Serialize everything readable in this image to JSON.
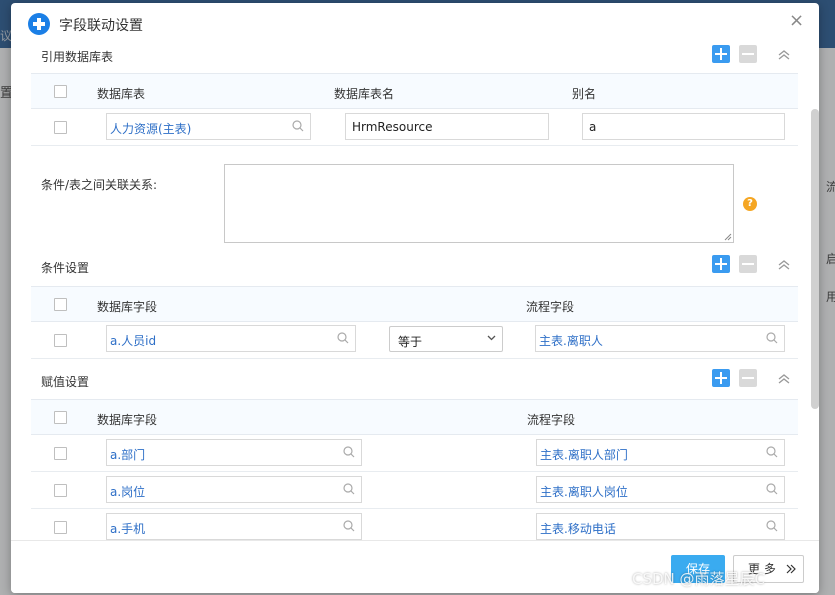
{
  "background": {
    "fragments": [
      "议",
      "置",
      "流",
      "启",
      "用"
    ]
  },
  "modal": {
    "title": "字段联动设置",
    "close_glyph": "×"
  },
  "ref_tables": {
    "title": "引用数据库表",
    "headers": [
      "数据库表",
      "数据库表名",
      "别名"
    ],
    "rows": [
      {
        "table": "人力资源(主表)",
        "table_name": "HrmResource",
        "alias": "a"
      }
    ]
  },
  "relation": {
    "label": "条件/表之间关联关系:",
    "help_glyph": "?"
  },
  "conditions": {
    "title": "条件设置",
    "headers": [
      "数据库字段",
      "流程字段"
    ],
    "rows": [
      {
        "db_field": "a.人员id",
        "operator": "等于",
        "flow_field": "主表.离职人"
      }
    ]
  },
  "assignments": {
    "title": "赋值设置",
    "headers": [
      "数据库字段",
      "流程字段"
    ],
    "rows": [
      {
        "db_field": "a.部门",
        "flow_field": "主表.离职人部门"
      },
      {
        "db_field": "a.岗位",
        "flow_field": "主表.离职人岗位"
      },
      {
        "db_field": "a.手机",
        "flow_field": "主表.移动电话"
      }
    ]
  },
  "footer": {
    "save_label": "保存",
    "more_label": "更 多"
  },
  "watermark": "CSDN @雨落星辰C",
  "colors": {
    "primary": "#3a9bf0",
    "link_text": "#2e6fc7",
    "help": "#f5a623"
  }
}
